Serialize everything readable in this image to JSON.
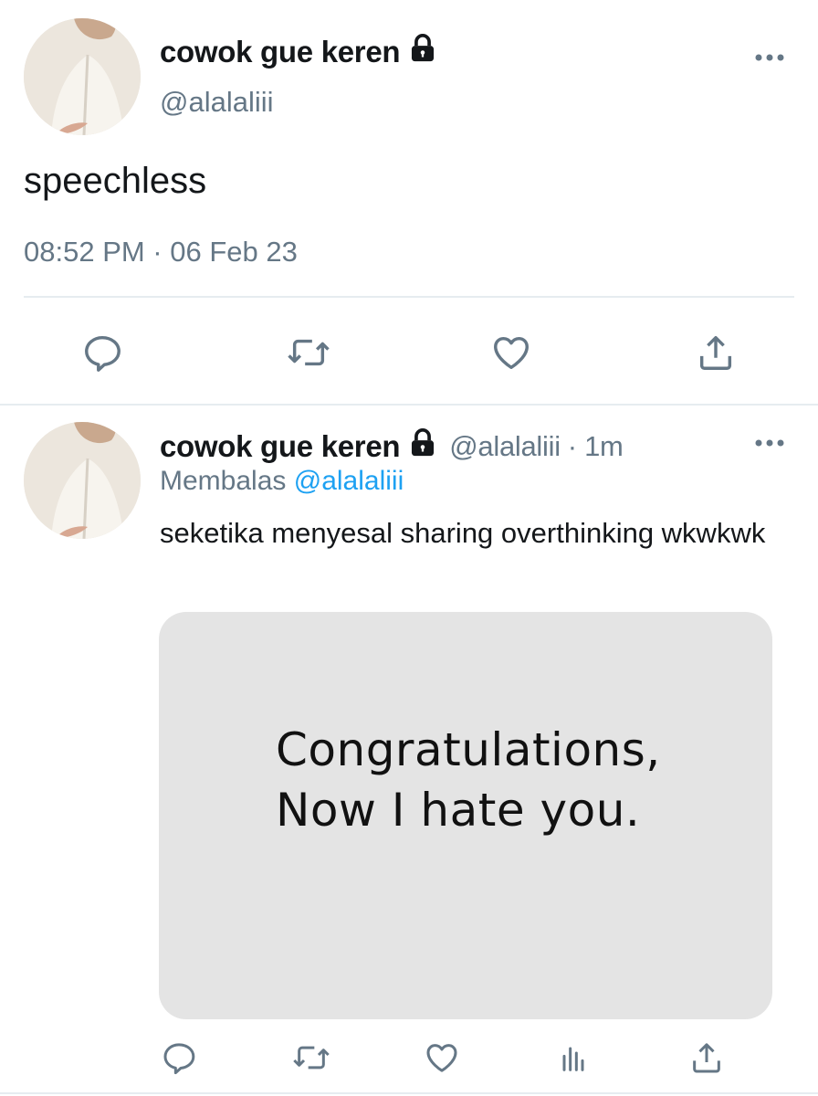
{
  "main_tweet": {
    "display_name": "cowok gue keren",
    "handle": "@alalaliii",
    "text": "speechless",
    "timestamp": "08:52 PM · 06 Feb 23",
    "actions": [
      "reply-icon",
      "retweet-icon",
      "like-icon",
      "share-icon"
    ]
  },
  "reply_tweet": {
    "display_name": "cowok gue keren",
    "handle": "@alalaliii",
    "time": "· 1m",
    "replying_prefix": "Membalas",
    "replying_to": "@alalaliii",
    "text": "seketika menyesal sharing overthinking wkwkwk",
    "media": {
      "line1": "Congratulations,",
      "line2": "Now I hate you."
    },
    "actions": [
      "reply-icon",
      "retweet-icon",
      "like-icon",
      "analytics-icon",
      "share-icon"
    ]
  },
  "colors": {
    "text": "#14171a",
    "secondary": "#657786",
    "accent": "#1da1f2",
    "divider": "#e6ecf0"
  }
}
